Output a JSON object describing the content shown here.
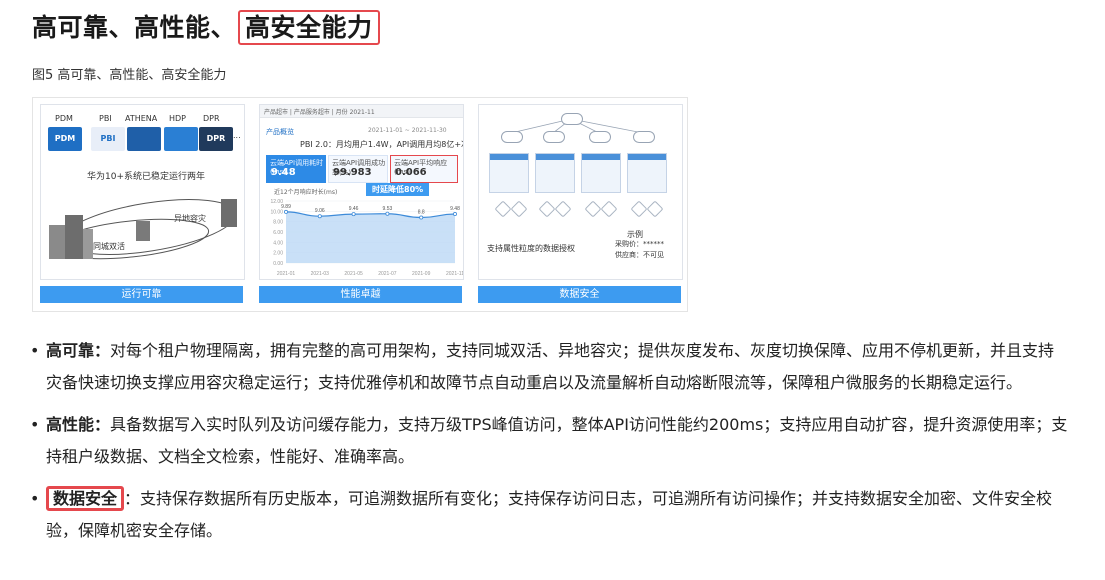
{
  "heading": {
    "plain": "高可靠、高性能、",
    "highlight": "高安全能力"
  },
  "caption": "图5 高可靠、高性能、高安全能力",
  "figure": {
    "panel1": {
      "logo_labels": [
        "PDM",
        "PBI",
        "ATHENA",
        "HDP",
        "DPR"
      ],
      "logo_texts": [
        "PDM",
        "PBI",
        "",
        "",
        "DPR"
      ],
      "more": "...",
      "subtitle": "华为10+系统已稳定运行两年",
      "label_remote": "异地容灾",
      "label_local": "同城双活",
      "button": "运行可靠"
    },
    "panel2": {
      "topbar": "产品超市 | 产品服务超市 | 月份 2021-11",
      "tab_label": "产品概览",
      "date_range": "2021-11-01 ~ 2021-11-30",
      "headline": "PBI 2.0：月均用户1.4W，API调用月均8亿+次",
      "kpis": [
        {
          "label": "云端API调用耗时(ms)",
          "value": "9.48"
        },
        {
          "label": "云端API调用成功率(%)",
          "value": "99.983"
        },
        {
          "label": "云端API平均响应(ms)",
          "value": "0.066"
        }
      ],
      "banner": "时延降低80%",
      "chart_title": "近12个月响应时长(ms)",
      "button": "性能卓越"
    },
    "panel3": {
      "caption": "支持属性粒度的数据授权",
      "legend_title": "示例",
      "legend_line1": "采购价：******",
      "legend_line2": "供应商：不可见",
      "button": "数据安全"
    }
  },
  "chart_data": {
    "type": "area",
    "title": "近12个月响应时长(ms)",
    "categories": [
      "2021-01",
      "2021-03",
      "2021-05",
      "2021-07",
      "2021-09",
      "2021-11"
    ],
    "values": [
      9.89,
      9.06,
      9.46,
      9.53,
      8.8,
      9.48
    ],
    "ylim": [
      0,
      12
    ],
    "ytick_labels": [
      "12.00",
      "10.00",
      "8.00",
      "6.00",
      "4.00",
      "2.00",
      "0.00"
    ],
    "colors": {
      "line": "#3d8bd9",
      "fill": "#bcd8f5"
    }
  },
  "bullets": [
    {
      "term": "高可靠：",
      "text": "对每个租户物理隔离，拥有完整的高可用架构，支持同城双活、异地容灾；提供灰度发布、灰度切换保障、应用不停机更新，并且支持灾备快速切换支撑应用容灾稳定运行；支持优雅停机和故障节点自动重启以及流量解析自动熔断限流等，保障租户微服务的长期稳定运行。"
    },
    {
      "term": "高性能：",
      "text": "具备数据写入实时队列及访问缓存能力，支持万级TPS峰值访问，整体API访问性能约200ms；支持应用自动扩容，提升资源使用率；支持租户级数据、文档全文检索，性能好、准确率高。"
    },
    {
      "term": "数据安全",
      "text": "：支持保存数据所有历史版本，可追溯数据所有变化；支持保存访问日志，可追溯所有访问操作；并支持数据安全加密、文件安全校验，保障机密安全存储。"
    }
  ],
  "bullet_marker": "•",
  "colors": {
    "accent_red": "#e5484d",
    "button_blue": "#3d9bf0"
  }
}
